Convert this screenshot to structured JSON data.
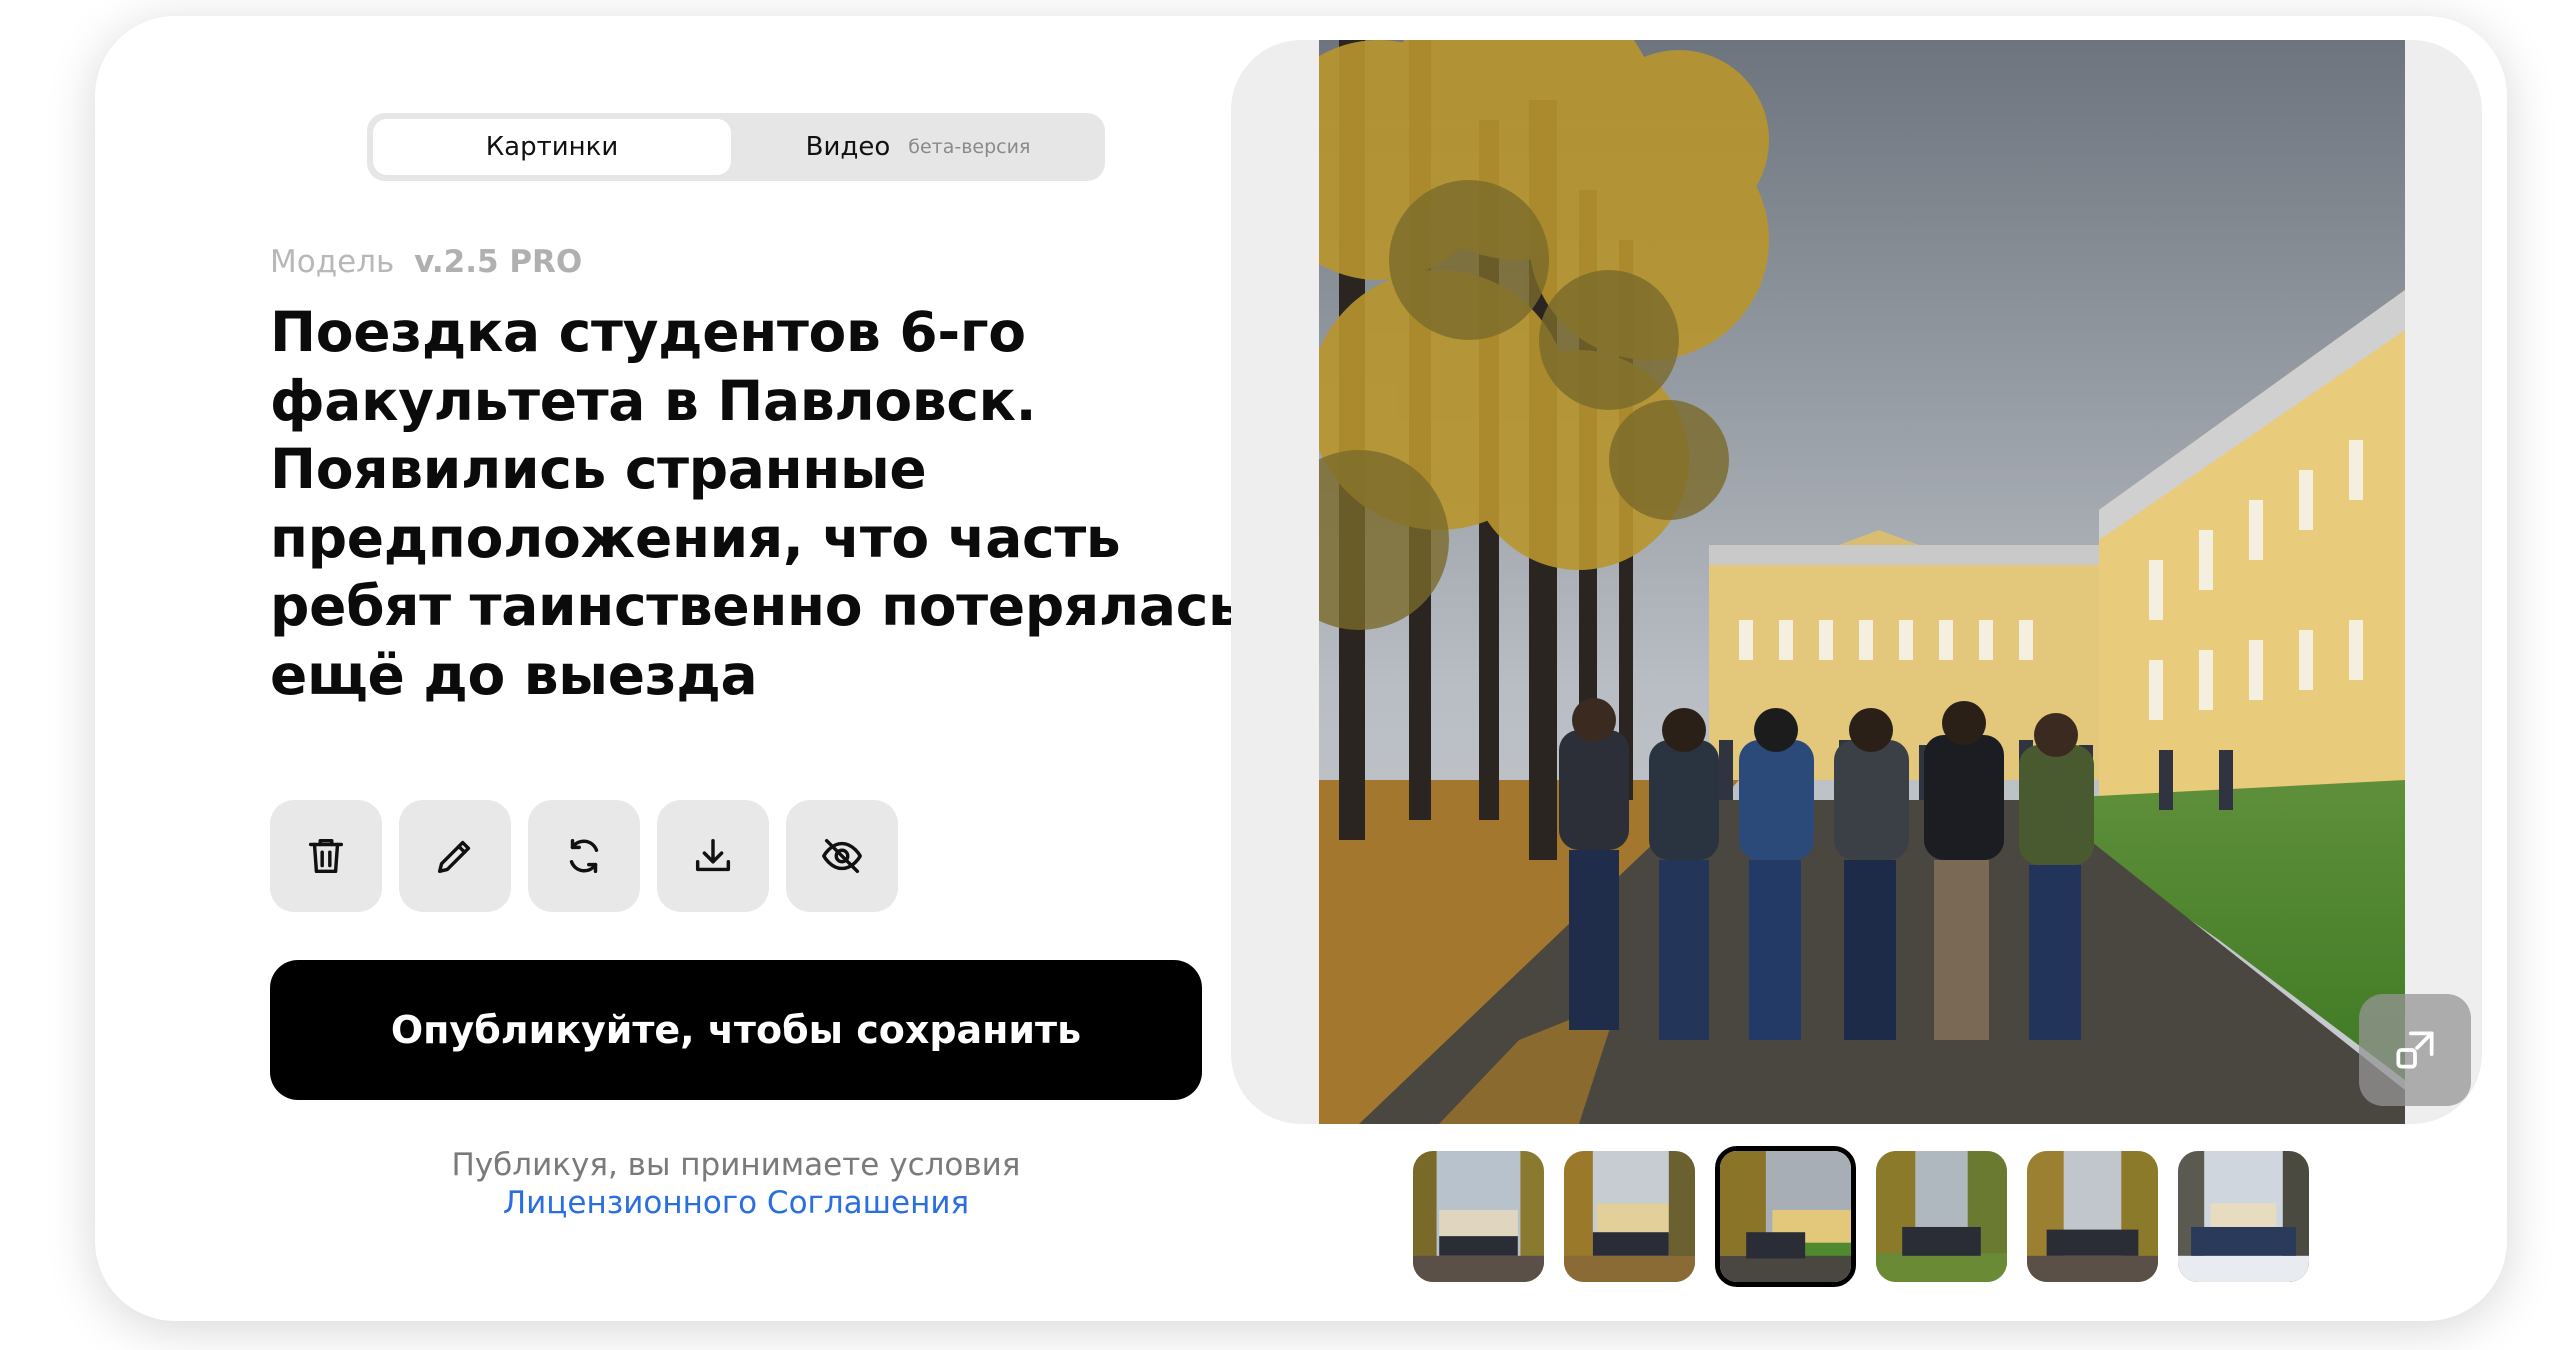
{
  "tabs": [
    {
      "label": "Картинки",
      "active": true
    },
    {
      "label": "Видео",
      "badge": "бета-версия",
      "active": false
    }
  ],
  "model": {
    "label": "Модель",
    "version": "v.2.5 PRO"
  },
  "prompt": "Поездка студентов 6-го факультета в Павловск. Появились странные предположения, что часть ребят таинственно потерялась ещё до выезда",
  "toolbar": [
    {
      "icon": "trash-icon"
    },
    {
      "icon": "pencil-icon"
    },
    {
      "icon": "regenerate-icon"
    },
    {
      "icon": "download-icon"
    },
    {
      "icon": "eye-off-icon"
    }
  ],
  "publish_button": "Опубликуйте, чтобы сохранить",
  "terms": {
    "text": "Публикуя, вы принимаете условия",
    "link": "Лицензионного Соглашения",
    "link_color": "#2a6fe0"
  },
  "preview": {
    "expand_icon": "expand-icon"
  },
  "thumbnails": {
    "count": 6,
    "selected_index": 2
  }
}
